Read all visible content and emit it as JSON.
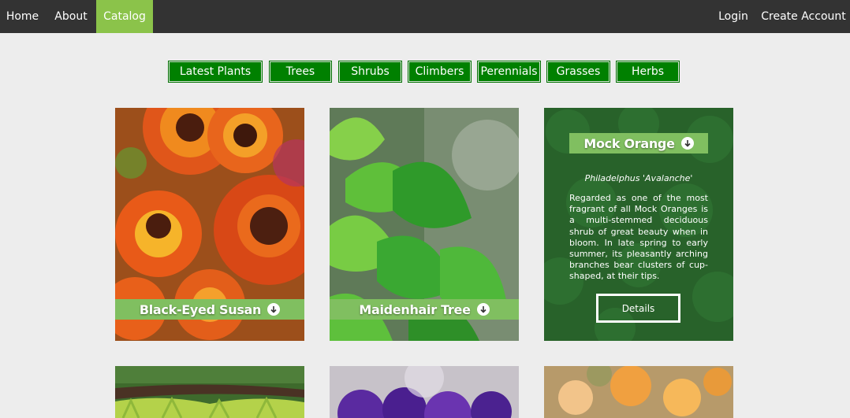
{
  "nav": {
    "home": "Home",
    "about": "About",
    "catalog": "Catalog",
    "login": "Login",
    "create_account": "Create Account"
  },
  "categories": [
    "Latest Plants",
    "Trees",
    "Shrubs",
    "Climbers",
    "Perennials",
    "Grasses",
    "Herbs"
  ],
  "cards": {
    "black_eyed_susan": {
      "title": "Black-Eyed Susan",
      "icon": "arrow-down-circle-icon"
    },
    "maidenhair_tree": {
      "title": "Maidenhair Tree",
      "icon": "arrow-down-circle-icon"
    },
    "mock_orange": {
      "title": "Mock Orange",
      "icon": "arrow-down-circle-icon",
      "scientific_name": "Philadelphus 'Avalanche'",
      "description": "Regarded as one of the most fragrant of all Mock Oranges is a multi-stemmed deciduous shrub of great beauty when in bloom. In late spring to early summer, its pleasantly arching branches bear clusters of cup-shaped, at their tips.",
      "details_label": "Details"
    }
  },
  "colors": {
    "nav_bg": "#333333",
    "nav_active": "#8bc34a",
    "category_bg": "#008000",
    "caption_bg": "#80bf60",
    "page_bg": "#ededed"
  }
}
